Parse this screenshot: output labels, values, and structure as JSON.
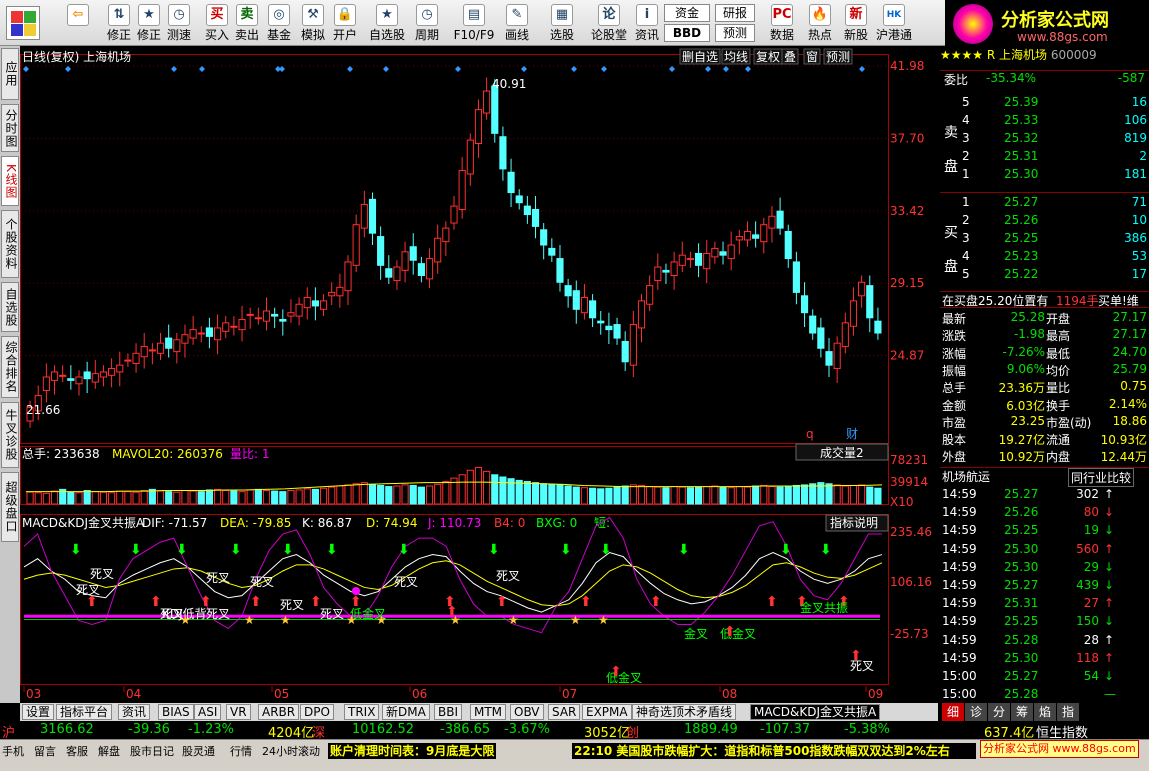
{
  "toolbar": [
    {
      "name": "back-button",
      "icon": "back-arrow-icon",
      "label": "",
      "x": 60
    },
    {
      "name": "update-button",
      "icon": "up-down-arrow-icon",
      "label": "修正",
      "x": 102
    },
    {
      "name": "correct-button",
      "icon": "star-icon",
      "label": "修正",
      "x": 132
    },
    {
      "name": "measure-button",
      "icon": "clock-icon",
      "label": "测速",
      "x": 162
    },
    {
      "name": "buy-button",
      "icon": "buy-icon",
      "label": "买入",
      "x": 200
    },
    {
      "name": "sell-button",
      "icon": "sell-icon",
      "label": "卖出",
      "x": 230
    },
    {
      "name": "fund-button",
      "icon": "fund-icon",
      "label": "基金",
      "x": 262
    },
    {
      "name": "simulate-button",
      "icon": "hammer-icon",
      "label": "模拟",
      "x": 296
    },
    {
      "name": "open-account-button",
      "icon": "lock-icon",
      "label": "开户",
      "x": 328
    },
    {
      "name": "watchlist-button",
      "icon": "star-icon",
      "label": "自选股",
      "x": 365
    },
    {
      "name": "period-button",
      "icon": "clock-icon",
      "label": "周期",
      "x": 410
    },
    {
      "name": "f10-button",
      "icon": "chart-icon",
      "label": "F10/F9",
      "x": 452
    },
    {
      "name": "draw-button",
      "icon": "pencil-icon",
      "label": "画线",
      "x": 500
    },
    {
      "name": "select-stock-button",
      "icon": "grid-icon",
      "label": "选股",
      "x": 545
    },
    {
      "name": "forum-button",
      "icon": "forum-icon",
      "label": "论股堂",
      "x": 587
    },
    {
      "name": "info-button",
      "icon": "info-icon",
      "label": "资讯",
      "x": 630
    }
  ],
  "toolbar_right": [
    {
      "name": "funds-button",
      "label": "资金"
    },
    {
      "name": "bbd-button",
      "label": "BBD"
    },
    {
      "name": "research-button",
      "label": "研报"
    },
    {
      "name": "forecast-button",
      "label": "预测"
    },
    {
      "name": "data-button",
      "label": "数据"
    },
    {
      "name": "hot-button",
      "label": "热点"
    },
    {
      "name": "new-stock-button",
      "label": "新股"
    },
    {
      "name": "hk-connect-button",
      "label": "沪港通"
    }
  ],
  "logo": {
    "title": "分析家公式网",
    "url": "www.88gs.com"
  },
  "left_tabs": [
    "应用",
    "分时图",
    "K线图",
    "个股资料",
    "自选股",
    "综合排名",
    "牛叉诊股",
    "超级盘口"
  ],
  "chart": {
    "header": "日线(复权) 上海机场",
    "header_buttons": [
      "删自选",
      "均线",
      "复权",
      "叠",
      "窗",
      "预测"
    ],
    "price_labels": [
      "41.98",
      "37.70",
      "33.42",
      "29.15",
      "24.87"
    ],
    "high_label": "40.91",
    "low_label": "21.66",
    "markers": [
      "q",
      "财"
    ],
    "volume_header": {
      "prefix": "总手: 233638",
      "mavol": "MAVOL20: 260376",
      "ratio": "量比: 1"
    },
    "volume_button": "成交量2",
    "volume_labels": [
      "78231",
      "39914",
      "X10"
    ],
    "indicator_header": {
      "name": "MACD&KDJ金叉共振A",
      "dif": "DIF: -71.57",
      "dea": "DEA: -79.85",
      "k": "K: 86.87",
      "d": "D: 74.94",
      "j": "J: 110.73",
      "b4": "B4: 0",
      "bxg": "BXG: 0",
      "short": "短:"
    },
    "indicator_button": "指标说明",
    "indicator_labels": [
      "235.46",
      "106.16",
      "-25.73"
    ],
    "dates": [
      "03",
      "04",
      "05",
      "06",
      "07",
      "08",
      "09"
    ],
    "annotations": [
      "死叉",
      "死叉",
      "死叉",
      "死叉",
      "死叉",
      "死叉",
      "死叉",
      "死叉",
      "死叉",
      "金叉",
      "金叉共振",
      "KDJ低背",
      "低金叉",
      "低金叉",
      "低金叉",
      "死叉",
      "死叉"
    ]
  },
  "chart_data": {
    "type": "candlestick",
    "title": "日线(复权) 上海机场",
    "ylim": [
      21.0,
      41.98
    ],
    "high": 40.91,
    "low": 21.66,
    "closes": [
      21.8,
      22.5,
      23.6,
      23.9,
      23.7,
      23.4,
      23.6,
      23.5,
      23.8,
      23.9,
      24.1,
      24.3,
      24.6,
      25.0,
      25.4,
      25.2,
      25.6,
      25.3,
      25.8,
      26.1,
      26.4,
      26.2,
      26.0,
      26.5,
      26.8,
      26.6,
      27.0,
      27.3,
      27.1,
      27.5,
      27.2,
      26.9,
      27.4,
      27.9,
      28.3,
      27.8,
      28.1,
      28.6,
      28.9,
      30.4,
      32.6,
      33.8,
      32.1,
      30.2,
      29.5,
      30.1,
      31.0,
      30.5,
      29.6,
      30.6,
      31.8,
      32.4,
      33.7,
      35.8,
      37.6,
      39.4,
      40.5,
      38.0,
      35.9,
      34.5,
      33.9,
      33.2,
      32.5,
      31.4,
      30.8,
      29.2,
      28.4,
      27.6,
      28.3,
      27.1,
      26.8,
      26.4,
      25.9,
      24.5,
      26.7,
      28.1,
      29.0,
      30.1,
      29.8,
      30.4,
      30.8,
      30.6,
      30.2,
      30.9,
      31.2,
      30.8,
      31.4,
      31.9,
      32.2,
      31.8,
      32.6,
      33.1,
      32.4,
      30.6,
      28.6,
      27.4,
      26.2,
      25.3,
      24.3,
      25.6,
      26.8,
      28.1,
      29.2,
      27.1,
      26.2
    ],
    "volume_ylim": [
      0,
      78231
    ],
    "volume": [
      21000,
      20000,
      19000,
      23000,
      26000,
      21000,
      20000,
      24000,
      22000,
      21000,
      20000,
      23000,
      22000,
      21000,
      24000,
      26000,
      23000,
      22000,
      21000,
      24000,
      23000,
      22000,
      25000,
      26000,
      24000,
      23000,
      22000,
      25000,
      26000,
      24000,
      23000,
      22000,
      24000,
      25000,
      27000,
      26000,
      28000,
      30000,
      32000,
      34000,
      36000,
      38000,
      35000,
      33000,
      31000,
      32000,
      34000,
      33000,
      30000,
      32000,
      35000,
      40000,
      46000,
      52000,
      60000,
      65000,
      58000,
      52000,
      48000,
      45000,
      42000,
      40000,
      38000,
      36000,
      35000,
      34000,
      32000,
      30000,
      29000,
      28000,
      27000,
      28000,
      30000,
      32000,
      34000,
      33000,
      31000,
      30000,
      29000,
      31000,
      30000,
      29000,
      30000,
      31000,
      32000,
      30000,
      29000,
      31000,
      30000,
      32000,
      33000,
      31000,
      30000,
      32000,
      33000,
      34000,
      36000,
      38000,
      36000,
      34000,
      32000,
      33000,
      34000,
      30000,
      28000
    ],
    "mavol": [
      22000,
      22000,
      22000,
      22000,
      22000,
      23000,
      23000,
      24000,
      24000,
      24000,
      25000,
      25000,
      26000,
      27000,
      29000,
      31000,
      33000,
      35000,
      36000,
      37000,
      38000,
      38000,
      39000,
      39000,
      38000,
      37000,
      36000,
      35000,
      33000,
      32000,
      31000,
      31000,
      31000,
      31000,
      31000,
      31000,
      31000,
      32000,
      32000,
      32000,
      32000,
      33000,
      33000,
      34000
    ],
    "indicator_ylim": [
      -100,
      260
    ],
    "indicator_series": [
      {
        "name": "K",
        "values": [
          180,
          200,
          170,
          150,
          120,
          110,
          105,
          140,
          160,
          175,
          190,
          200,
          180,
          150,
          120,
          105,
          110,
          140,
          170,
          200,
          210,
          190,
          160,
          140,
          120,
          110,
          120,
          150,
          180,
          200,
          210,
          205,
          170,
          140,
          120,
          110,
          95,
          80,
          70,
          85,
          100,
          140,
          190,
          215,
          205,
          170,
          140,
          115,
          100,
          90,
          95,
          110,
          130,
          160,
          200,
          215,
          200,
          170,
          150,
          140,
          150,
          170,
          200,
          210
        ]
      },
      {
        "name": "D",
        "values": [
          150,
          160,
          165,
          160,
          150,
          140,
          130,
          135,
          145,
          155,
          165,
          175,
          178,
          170,
          155,
          140,
          130,
          135,
          150,
          170,
          185,
          185,
          175,
          160,
          145,
          130,
          125,
          135,
          155,
          175,
          190,
          195,
          185,
          165,
          145,
          130,
          115,
          100,
          88,
          85,
          90,
          110,
          140,
          170,
          185,
          180,
          165,
          145,
          125,
          110,
          105,
          108,
          118,
          135,
          160,
          185,
          190,
          180,
          165,
          155,
          152,
          160,
          175,
          190
        ]
      },
      {
        "name": "J",
        "values": [
          230,
          260,
          170,
          110,
          50,
          40,
          50,
          150,
          200,
          220,
          240,
          250,
          180,
          110,
          50,
          30,
          60,
          150,
          220,
          260,
          270,
          210,
          130,
          90,
          60,
          60,
          110,
          180,
          230,
          250,
          250,
          230,
          150,
          90,
          60,
          60,
          40,
          30,
          20,
          80,
          120,
          200,
          280,
          300,
          250,
          150,
          90,
          60,
          40,
          40,
          70,
          110,
          160,
          220,
          280,
          290,
          230,
          150,
          110,
          100,
          140,
          200,
          260,
          260
        ]
      }
    ]
  },
  "right_panel": {
    "title": "R 上海机场",
    "code": "600009",
    "wei_bi": {
      "label": "委比",
      "pct": "-35.34%",
      "diff": "-587"
    },
    "sell_side_label": "卖盘",
    "sells": [
      {
        "n": "5",
        "p": "25.39",
        "v": "16"
      },
      {
        "n": "4",
        "p": "25.33",
        "v": "106"
      },
      {
        "n": "3",
        "p": "25.32",
        "v": "819"
      },
      {
        "n": "2",
        "p": "25.31",
        "v": "2"
      },
      {
        "n": "1",
        "p": "25.30",
        "v": "181"
      }
    ],
    "buy_side_label": "买盘",
    "buys": [
      {
        "n": "1",
        "p": "25.27",
        "v": "71"
      },
      {
        "n": "2",
        "p": "25.26",
        "v": "10"
      },
      {
        "n": "3",
        "p": "25.25",
        "v": "386"
      },
      {
        "n": "4",
        "p": "25.23",
        "v": "53"
      },
      {
        "n": "5",
        "p": "25.22",
        "v": "17"
      }
    ],
    "position_line": {
      "text": "在买盘25.20位置有",
      "vol": "1194手",
      "suffix": "买单!维"
    },
    "stats": [
      {
        "l": "最新",
        "v": "25.28",
        "l2": "开盘",
        "v2": "27.17"
      },
      {
        "l": "涨跌",
        "v": "-1.98",
        "l2": "最高",
        "v2": "27.17"
      },
      {
        "l": "涨幅",
        "v": "-7.26%",
        "l2": "最低",
        "v2": "24.70"
      },
      {
        "l": "振幅",
        "v": "9.06%",
        "l2": "均价",
        "v2": "25.79"
      },
      {
        "l": "总手",
        "v": "23.36万",
        "l2": "量比",
        "v2": "0.75"
      },
      {
        "l": "金额",
        "v": "6.03亿",
        "l2": "换手",
        "v2": "2.14%"
      },
      {
        "l": "市盈",
        "v": "23.25",
        "l2": "市盈(动)",
        "v2": "18.86"
      },
      {
        "l": "股本",
        "v": "19.27亿",
        "l2": "流通",
        "v2": "10.93亿"
      },
      {
        "l": "外盘",
        "v": "10.92万",
        "l2": "内盘",
        "v2": "12.44万"
      }
    ],
    "industry_tabs": [
      "机场航运",
      "同行业比较"
    ],
    "trades": [
      {
        "t": "14:59",
        "p": "25.27",
        "v": "302",
        "d": "up-white"
      },
      {
        "t": "14:59",
        "p": "25.26",
        "v": "80",
        "d": "down-red"
      },
      {
        "t": "14:59",
        "p": "25.25",
        "v": "19",
        "d": "down-green"
      },
      {
        "t": "14:59",
        "p": "25.30",
        "v": "560",
        "d": "up-red"
      },
      {
        "t": "14:59",
        "p": "25.30",
        "v": "29",
        "d": "down-green"
      },
      {
        "t": "14:59",
        "p": "25.27",
        "v": "439",
        "d": "down-green"
      },
      {
        "t": "14:59",
        "p": "25.31",
        "v": "27",
        "d": "up-red"
      },
      {
        "t": "14:59",
        "p": "25.25",
        "v": "150",
        "d": "down-green"
      },
      {
        "t": "14:59",
        "p": "25.28",
        "v": "28",
        "d": "up-white"
      },
      {
        "t": "14:59",
        "p": "25.30",
        "v": "118",
        "d": "up-red"
      },
      {
        "t": "15:00",
        "p": "25.27",
        "v": "54",
        "d": "down-green"
      },
      {
        "t": "15:00",
        "p": "25.28",
        "v": "",
        "d": "dash"
      }
    ],
    "bottom_tabs": [
      "细",
      "诊",
      "分",
      "筹",
      "焰",
      "指"
    ]
  },
  "bottom_tabs": [
    "设置",
    "指标平台",
    "资讯",
    "BIAS",
    "ASI",
    "VR",
    "ARBR",
    "DPO",
    "TRIX",
    "新DMA",
    "BBI",
    "MTM",
    "OBV",
    "SAR",
    "EXPMA",
    "神奇选顶术矛盾线",
    "MACD&KDJ金叉共振A"
  ],
  "index_bar": {
    "sh_label": "沪",
    "sh_val": "3166.62",
    "sh_chg": "-39.36",
    "sh_pct": "-1.23%",
    "sh_amt": "4204亿",
    "sz_label": "深",
    "sz_val": "10162.52",
    "sz_chg": "-386.65",
    "sz_pct": "-3.67%",
    "sz_amt": "3052亿",
    "cy_label": "创",
    "cy_val": "1889.49",
    "cy_chg": "-107.37",
    "cy_pct": "-5.38%",
    "cy_amt": "637.4亿",
    "extra": "恒生指数"
  },
  "status_bar": {
    "items": [
      "手机",
      "留言",
      "客服",
      "解盘",
      "股市日记",
      "股灵通",
      "行情",
      "24小时滚动"
    ],
    "ticker1": "账户清理时间表：9月底是大限",
    "ticker2": "22:10 美国股市跌幅扩大：道指和标普500指数跌幅双双达到2%左右",
    "watermark": "分析家公式网 www.88gs.com"
  }
}
